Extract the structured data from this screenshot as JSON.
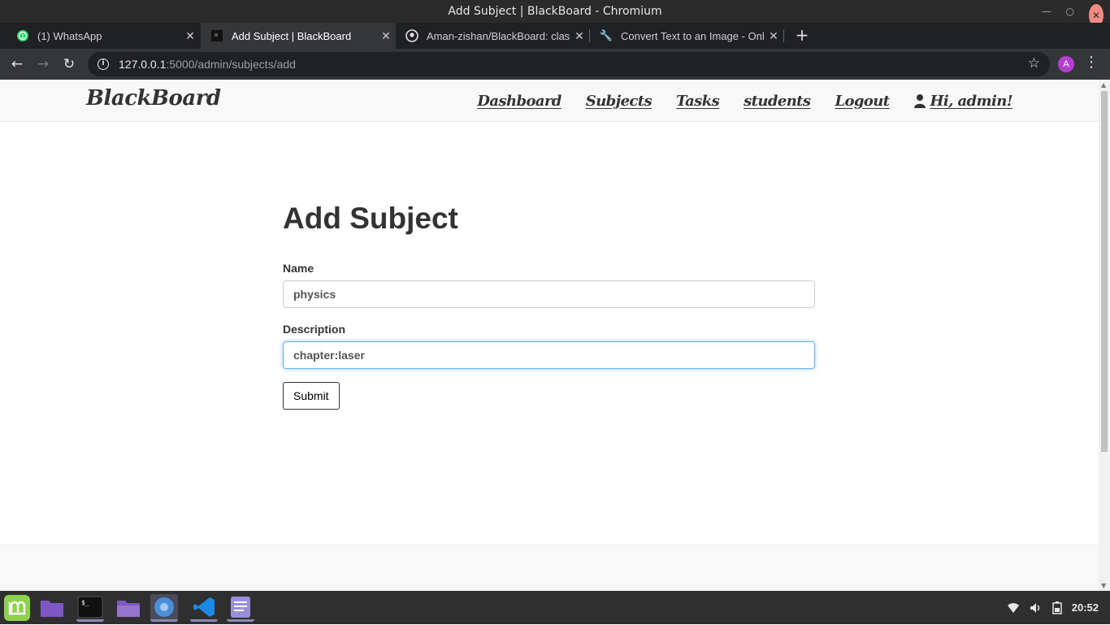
{
  "window": {
    "title": "Add Subject | BlackBoard - Chromium"
  },
  "tabs": [
    {
      "title": "(1) WhatsApp",
      "icon": "whatsapp-icon"
    },
    {
      "title": "Add Subject | BlackBoard",
      "icon": "blackboard-favicon"
    },
    {
      "title": "Aman-zishan/BlackBoard: class",
      "icon": "github-icon"
    },
    {
      "title": "Convert Text to an Image - Onli",
      "icon": "wrench-icon"
    }
  ],
  "address": {
    "host": "127.0.0.1",
    "path": ":5000/admin/subjects/add"
  },
  "profile_initial": "A",
  "site": {
    "brand": "BlackBoard",
    "nav": [
      "Dashboard",
      "Subjects",
      "Tasks",
      "students",
      "Logout"
    ],
    "user": "Hi, admin!"
  },
  "form": {
    "title": "Add Subject",
    "name_label": "Name",
    "name_value": "physics",
    "description_label": "Description",
    "description_value": "chapter:laser",
    "submit_label": "Submit"
  },
  "taskbar": {
    "clock": "20:52"
  },
  "colors": {
    "accent": "#66afe9",
    "whatsapp": "#25d366",
    "profile": "#b63fd1"
  }
}
